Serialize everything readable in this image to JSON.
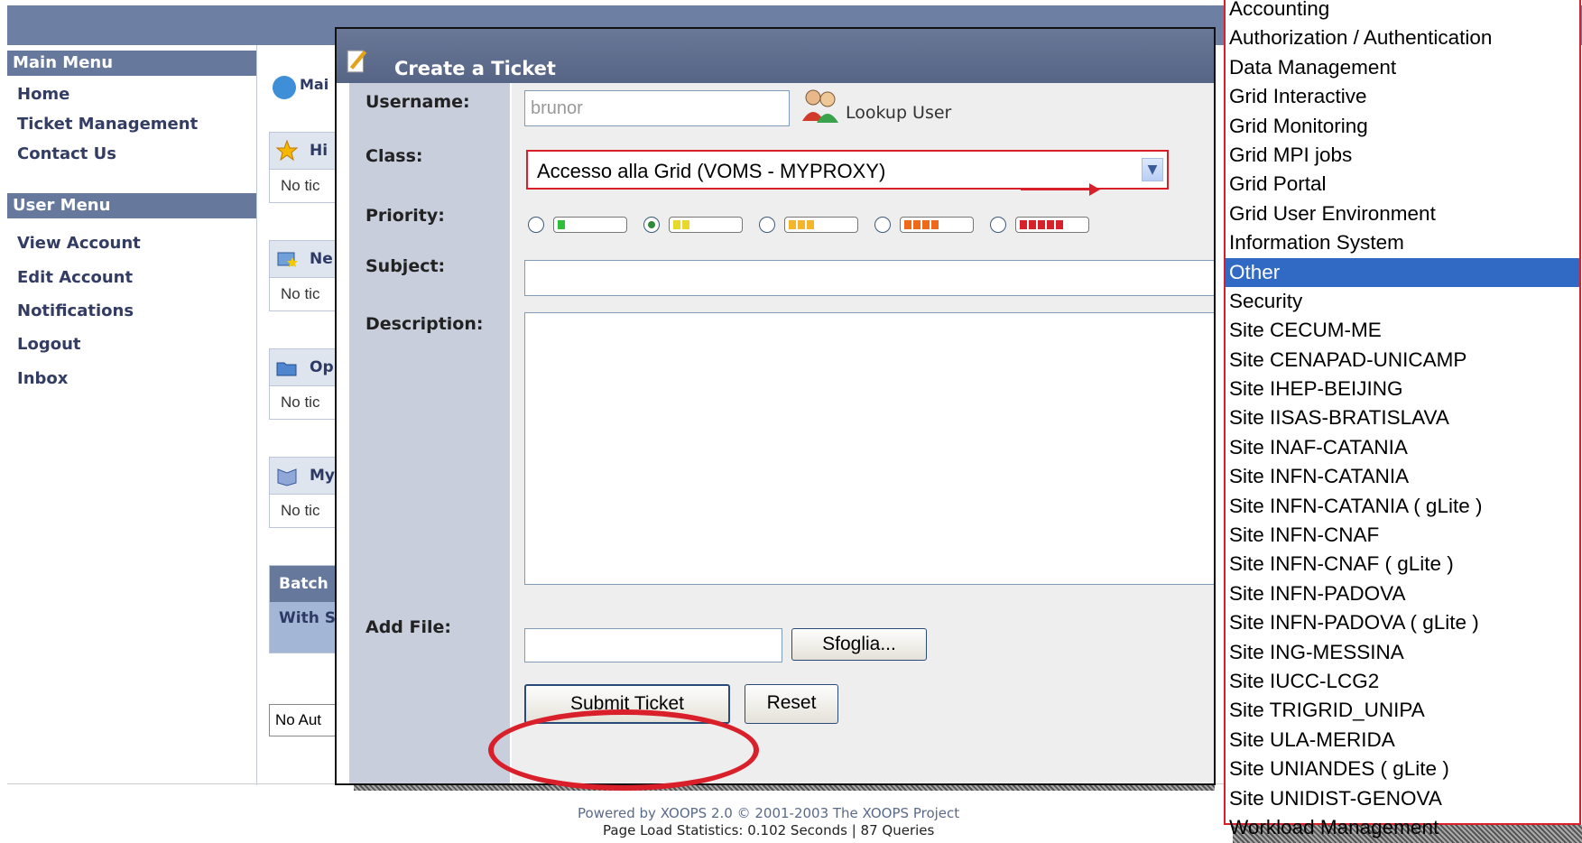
{
  "left_menu": {
    "main_title": "Main Menu",
    "main_items": [
      {
        "label": "Home"
      },
      {
        "label": "Ticket Management"
      },
      {
        "label": "Contact Us"
      }
    ],
    "user_title": "User Menu",
    "user_items": [
      {
        "label": "View Account"
      },
      {
        "label": "Edit Account"
      },
      {
        "label": "Notifications"
      },
      {
        "label": "Logout"
      },
      {
        "label": "Inbox"
      }
    ]
  },
  "background": {
    "main_title": "Mai",
    "blocks": [
      {
        "title": "Hi",
        "body": "No tic"
      },
      {
        "title": "Ne",
        "body": "No tic"
      },
      {
        "title": "Op",
        "body": "No tic"
      },
      {
        "title": "My",
        "body": "No tic"
      }
    ],
    "batch_title": "Batch",
    "batch_body": "With S",
    "select_value": "No Aut"
  },
  "dialog": {
    "title": "Create a Ticket",
    "username_label": "Username:",
    "username_value": "brunor",
    "lookup_label": "Lookup User",
    "class_label": "Class:",
    "class_value": "Accesso alla Grid (VOMS - MYPROXY)",
    "priority_label": "Priority:",
    "priority_selected": 2,
    "subject_label": "Subject:",
    "subject_value": "",
    "description_label": "Description:",
    "description_value": "",
    "addfile_label": "Add File:",
    "browse_label": "Sfoglia...",
    "submit_label": "Submit Ticket",
    "reset_label": "Reset"
  },
  "dropdown": {
    "options": [
      "Accounting",
      "Authorization / Authentication",
      "Data Management",
      "Grid Interactive",
      "Grid Monitoring",
      "Grid MPI jobs",
      "Grid Portal",
      "Grid User Environment",
      "Information System",
      "Other",
      "Security",
      "Site CECUM-ME",
      "Site CENAPAD-UNICAMP",
      "Site IHEP-BEIJING",
      "Site IISAS-BRATISLAVA",
      "Site INAF-CATANIA",
      "Site INFN-CATANIA",
      "Site INFN-CATANIA ( gLite )",
      "Site INFN-CNAF",
      "Site INFN-CNAF ( gLite )",
      "Site INFN-PADOVA",
      "Site INFN-PADOVA ( gLite )",
      "Site ING-MESSINA",
      "Site IUCC-LCG2",
      "Site TRIGRID_UNIPA",
      "Site ULA-MERIDA",
      "Site UNIANDES ( gLite )",
      "Site UNIDIST-GENOVA",
      "Workload Management"
    ],
    "selected": "Other"
  },
  "footer": {
    "powered": "Powered by XOOPS 2.0 © 2001-2003 The XOOPS Project",
    "stats": "Page Load Statistics: 0.102 Seconds | 87 Queries"
  },
  "colors": {
    "header": "#6d7fa3",
    "menu_head": "#66789c",
    "label_bg": "#c8cedb",
    "annotation_red": "#d9202a",
    "selection_blue": "#316ac5"
  }
}
